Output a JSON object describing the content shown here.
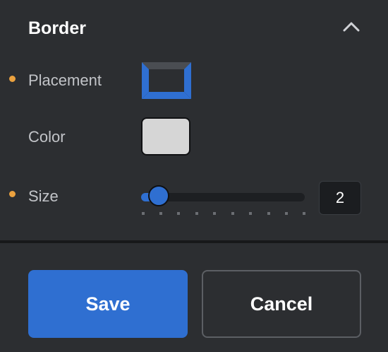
{
  "section": {
    "title": "Border",
    "collapse_icon": "chevron-up-icon"
  },
  "fields": {
    "placement": {
      "label": "Placement",
      "modified": true
    },
    "color": {
      "label": "Color",
      "value": "#d6d6d6",
      "modified": false
    },
    "size": {
      "label": "Size",
      "value": "2",
      "modified": true
    }
  },
  "colors": {
    "accent": "#2f6fd1",
    "modified_dot": "#eba23f",
    "background": "#2c2e31"
  },
  "buttons": {
    "save_label": "Save",
    "cancel_label": "Cancel"
  }
}
